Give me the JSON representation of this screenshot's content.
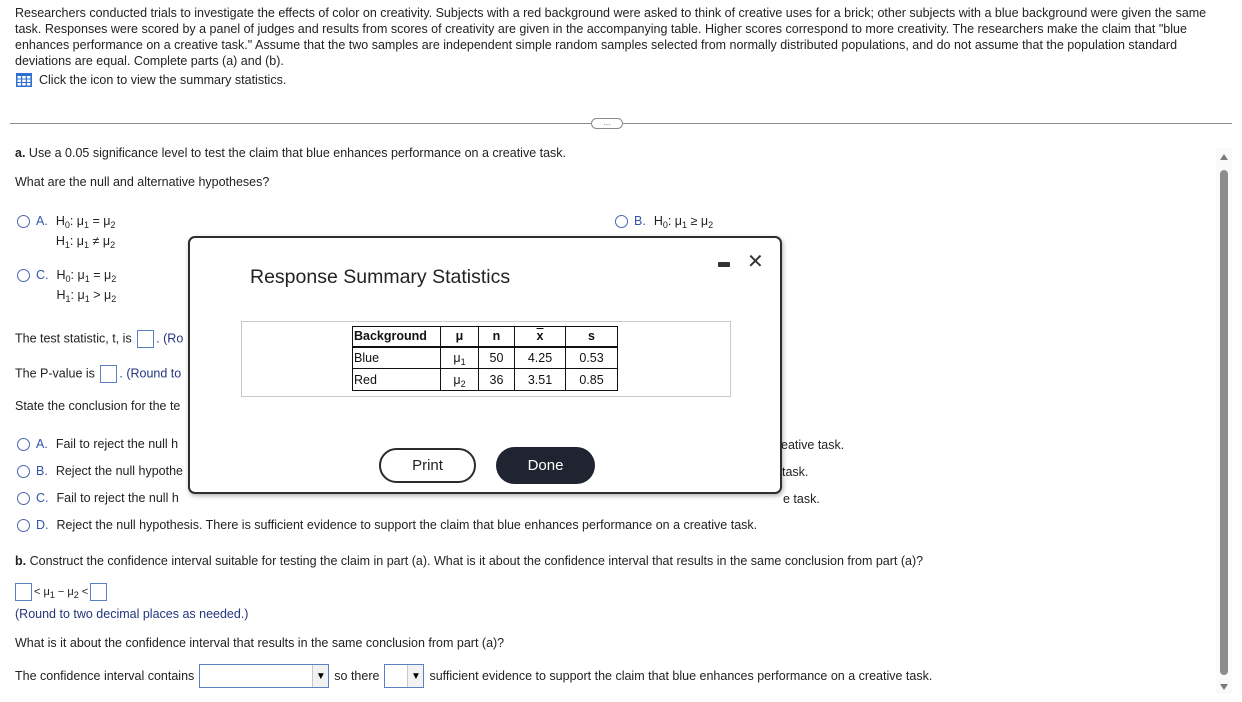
{
  "intro": {
    "text": "Researchers conducted trials to investigate the effects of color on creativity. Subjects with a red background were asked to think of creative uses for a brick; other subjects with a blue background were given the same task. Responses were scored by a panel of judges and results from scores of creativity are given in the accompanying table. Higher scores correspond to more creativity. The researchers make the claim that \"blue enhances performance on a creative task.\" Assume that the two samples are independent simple random samples selected from normally distributed populations, and do not assume that the population standard deviations are equal. Complete parts (a) and (b).",
    "icon_link": "Click the icon to view the summary statistics.",
    "icon": "table-grid-icon"
  },
  "more_button": "...",
  "part_a": {
    "label": "a.",
    "prompt": "Use a 0.05 significance level to test the claim that blue enhances performance on a creative task.",
    "question": "What are the null and alternative hypotheses?",
    "hypotheses": [
      {
        "letter": "A.",
        "h0": "H",
        "h0_sub": "0",
        "h0_rel": "=",
        "h1_rel": "≠"
      },
      {
        "letter": "B.",
        "h0_rel": "≥"
      },
      {
        "letter": "C.",
        "h0_rel": "=",
        "h1_rel": ">"
      }
    ],
    "test_stat_prefix": "The test statistic, t, is",
    "test_stat_suffix": ". (Ro",
    "pvalue_prefix": "The P-value is",
    "pvalue_suffix": ". (Round to",
    "conclusion_prompt": "State the conclusion for the te",
    "conclusions": [
      {
        "letter": "A.",
        "text": "Fail to reject the null h",
        "tail": "eative task."
      },
      {
        "letter": "B.",
        "text": "Reject the null hypothe",
        "tail": "task."
      },
      {
        "letter": "C.",
        "text": "Fail to reject the null h",
        "tail": "e task."
      },
      {
        "letter": "D.",
        "text": "Reject the null hypothesis. There is sufficient evidence to support the claim that blue enhances performance on a creative task.",
        "tail": ""
      }
    ]
  },
  "part_b": {
    "label": "b.",
    "prompt": "Construct the confidence interval suitable for testing the claim in part (a). What is it about the confidence interval that results in the same conclusion from part (a)?",
    "round_note": "(Round to two decimal places as needed.)",
    "question": "What is it about the confidence interval that results in the same conclusion from part (a)?",
    "ci_prefix": "The confidence interval contains",
    "ci_select_value": "",
    "ci_middle": "so there",
    "ci_select2_value": "",
    "ci_suffix": "sufficient evidence to support the claim that blue enhances performance on a creative task."
  },
  "modal": {
    "title": "Response Summary Statistics",
    "minimize_icon": "minimize-icon",
    "close_icon": "close-icon",
    "table": {
      "headers": [
        "Background",
        "μ",
        "n",
        "x",
        "s"
      ],
      "rows": [
        {
          "background": "Blue",
          "mu": "μ",
          "mu_sub": "1",
          "n": "50",
          "xbar": "4.25",
          "s": "0.53"
        },
        {
          "background": "Red",
          "mu": "μ",
          "mu_sub": "2",
          "n": "36",
          "xbar": "3.51",
          "s": "0.85"
        }
      ]
    },
    "print_label": "Print",
    "done_label": "Done"
  }
}
